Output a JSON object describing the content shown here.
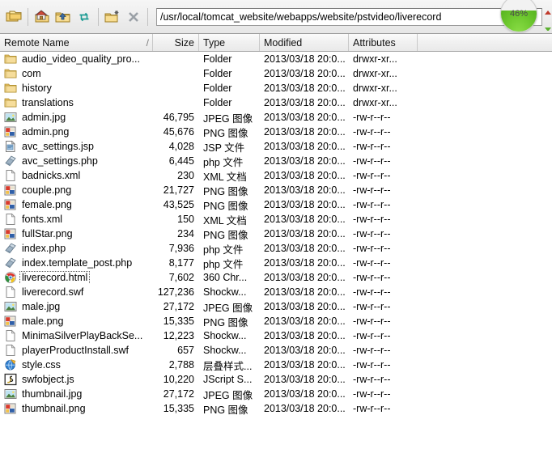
{
  "toolbar": {
    "buttons": [
      {
        "name": "open-folder-pair-button",
        "icon": "folder-pair-icon",
        "title": "Open"
      },
      {
        "name": "home-folder-button",
        "icon": "home-folder-icon",
        "title": "Home"
      },
      {
        "name": "up-folder-button",
        "icon": "up-folder-icon",
        "title": "Up one level"
      },
      {
        "name": "refresh-button",
        "icon": "refresh-icon",
        "title": "Refresh"
      },
      {
        "name": "new-folder-button",
        "icon": "new-folder-icon",
        "title": "New folder"
      },
      {
        "name": "delete-button",
        "icon": "close-x-icon",
        "title": "Delete"
      }
    ],
    "address_value": "/usr/local/tomcat_website/webapps/website/pstvideo/liverecord",
    "address_placeholder": "",
    "progress_percent": "46%",
    "progress_value": 46,
    "progress_color": "#6fc92f"
  },
  "columns": [
    {
      "key": "name",
      "label": "Remote Name",
      "sort_indicator": "/"
    },
    {
      "key": "size",
      "label": "Size",
      "sort_indicator": ""
    },
    {
      "key": "type",
      "label": "Type",
      "sort_indicator": ""
    },
    {
      "key": "mod",
      "label": "Modified",
      "sort_indicator": ""
    },
    {
      "key": "attr",
      "label": "Attributes",
      "sort_indicator": ""
    }
  ],
  "rows": [
    {
      "name": "audio_video_quality_pro...",
      "size": "",
      "type": "Folder",
      "modified": "2013/03/18 20:0...",
      "attributes": "drwxr-xr...",
      "icon": "folder-icon",
      "focused": false
    },
    {
      "name": "com",
      "size": "",
      "type": "Folder",
      "modified": "2013/03/18 20:0...",
      "attributes": "drwxr-xr...",
      "icon": "folder-icon",
      "focused": false
    },
    {
      "name": "history",
      "size": "",
      "type": "Folder",
      "modified": "2013/03/18 20:0...",
      "attributes": "drwxr-xr...",
      "icon": "folder-icon",
      "focused": false
    },
    {
      "name": "translations",
      "size": "",
      "type": "Folder",
      "modified": "2013/03/18 20:0...",
      "attributes": "drwxr-xr...",
      "icon": "folder-icon",
      "focused": false
    },
    {
      "name": "admin.jpg",
      "size": "46,795",
      "type": "JPEG 图像",
      "modified": "2013/03/18 20:0...",
      "attributes": "-rw-r--r--",
      "icon": "jpeg-image-icon",
      "focused": false
    },
    {
      "name": "admin.png",
      "size": "45,676",
      "type": "PNG 图像",
      "modified": "2013/03/18 20:0...",
      "attributes": "-rw-r--r--",
      "icon": "png-image-icon",
      "focused": false
    },
    {
      "name": "avc_settings.jsp",
      "size": "4,028",
      "type": "JSP 文件",
      "modified": "2013/03/18 20:0...",
      "attributes": "-rw-r--r--",
      "icon": "jsp-file-icon",
      "focused": false
    },
    {
      "name": "avc_settings.php",
      "size": "6,445",
      "type": "php 文件",
      "modified": "2013/03/18 20:0...",
      "attributes": "-rw-r--r--",
      "icon": "php-file-icon",
      "focused": false
    },
    {
      "name": "badnicks.xml",
      "size": "230",
      "type": "XML 文档",
      "modified": "2013/03/18 20:0...",
      "attributes": "-rw-r--r--",
      "icon": "blank-doc-icon",
      "focused": false
    },
    {
      "name": "couple.png",
      "size": "21,727",
      "type": "PNG 图像",
      "modified": "2013/03/18 20:0...",
      "attributes": "-rw-r--r--",
      "icon": "png-image-icon",
      "focused": false
    },
    {
      "name": "female.png",
      "size": "43,525",
      "type": "PNG 图像",
      "modified": "2013/03/18 20:0...",
      "attributes": "-rw-r--r--",
      "icon": "png-image-icon",
      "focused": false
    },
    {
      "name": "fonts.xml",
      "size": "150",
      "type": "XML 文档",
      "modified": "2013/03/18 20:0...",
      "attributes": "-rw-r--r--",
      "icon": "blank-doc-icon",
      "focused": false
    },
    {
      "name": "fullStar.png",
      "size": "234",
      "type": "PNG 图像",
      "modified": "2013/03/18 20:0...",
      "attributes": "-rw-r--r--",
      "icon": "png-image-icon",
      "focused": false
    },
    {
      "name": "index.php",
      "size": "7,936",
      "type": "php 文件",
      "modified": "2013/03/18 20:0...",
      "attributes": "-rw-r--r--",
      "icon": "php-file-icon",
      "focused": false
    },
    {
      "name": "index.template_post.php",
      "size": "8,177",
      "type": "php 文件",
      "modified": "2013/03/18 20:0...",
      "attributes": "-rw-r--r--",
      "icon": "php-file-icon",
      "focused": false
    },
    {
      "name": "liverecord.html",
      "size": "7,602",
      "type": "360 Chr...",
      "modified": "2013/03/18 20:0...",
      "attributes": "-rw-r--r--",
      "icon": "chrome-360-icon",
      "focused": true
    },
    {
      "name": "liverecord.swf",
      "size": "127,236",
      "type": "Shockw...",
      "modified": "2013/03/18 20:0...",
      "attributes": "-rw-r--r--",
      "icon": "blank-doc-icon",
      "focused": false
    },
    {
      "name": "male.jpg",
      "size": "27,172",
      "type": "JPEG 图像",
      "modified": "2013/03/18 20:0...",
      "attributes": "-rw-r--r--",
      "icon": "jpeg-image-icon",
      "focused": false
    },
    {
      "name": "male.png",
      "size": "15,335",
      "type": "PNG 图像",
      "modified": "2013/03/18 20:0...",
      "attributes": "-rw-r--r--",
      "icon": "png-image-icon",
      "focused": false
    },
    {
      "name": "MinimaSilverPlayBackSe...",
      "size": "12,223",
      "type": "Shockw...",
      "modified": "2013/03/18 20:0...",
      "attributes": "-rw-r--r--",
      "icon": "blank-doc-icon",
      "focused": false
    },
    {
      "name": "playerProductInstall.swf",
      "size": "657",
      "type": "Shockw...",
      "modified": "2013/03/18 20:0...",
      "attributes": "-rw-r--r--",
      "icon": "blank-doc-icon",
      "focused": false
    },
    {
      "name": "style.css",
      "size": "2,788",
      "type": "层叠样式...",
      "modified": "2013/03/18 20:0...",
      "attributes": "-rw-r--r--",
      "icon": "css-globe-icon",
      "focused": false
    },
    {
      "name": "swfobject.js",
      "size": "10,220",
      "type": "JScript S...",
      "modified": "2013/03/18 20:0...",
      "attributes": "-rw-r--r--",
      "icon": "jscript-icon",
      "focused": false
    },
    {
      "name": "thumbnail.jpg",
      "size": "27,172",
      "type": "JPEG 图像",
      "modified": "2013/03/18 20:0...",
      "attributes": "-rw-r--r--",
      "icon": "jpeg-image-icon",
      "focused": false
    },
    {
      "name": "thumbnail.png",
      "size": "15,335",
      "type": "PNG 图像",
      "modified": "2013/03/18 20:0...",
      "attributes": "-rw-r--r--",
      "icon": "png-image-icon",
      "focused": false
    }
  ]
}
